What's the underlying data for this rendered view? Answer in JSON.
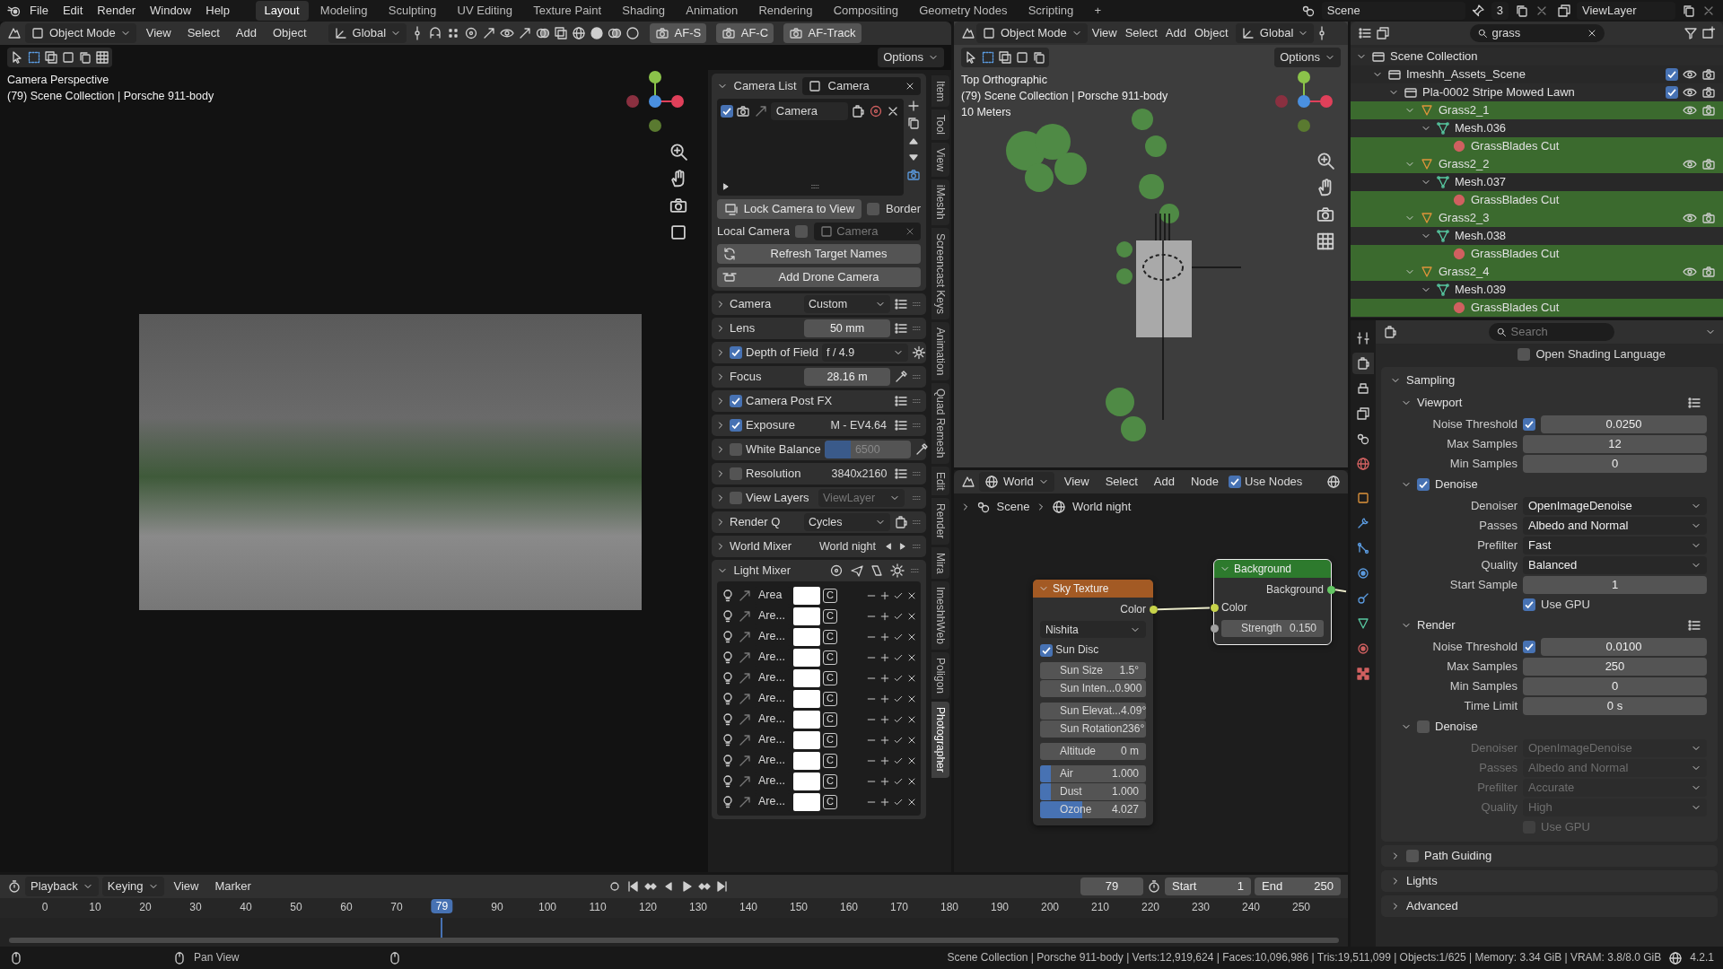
{
  "menu": [
    "File",
    "Edit",
    "Render",
    "Window",
    "Help"
  ],
  "workspaces": [
    {
      "label": "Layout",
      "selected": true
    },
    {
      "label": "Modeling",
      "selected": false
    },
    {
      "label": "Sculpting",
      "selected": false
    },
    {
      "label": "UV Editing",
      "selected": false
    },
    {
      "label": "Texture Paint",
      "selected": false
    },
    {
      "label": "Shading",
      "selected": false
    },
    {
      "label": "Animation",
      "selected": false
    },
    {
      "label": "Rendering",
      "selected": false
    },
    {
      "label": "Compositing",
      "selected": false
    },
    {
      "label": "Geometry Nodes",
      "selected": false
    },
    {
      "label": "Scripting",
      "selected": false
    }
  ],
  "add_workspace": "+",
  "scene": {
    "name": "Scene",
    "users": "3"
  },
  "view_layer": "ViewLayer",
  "viewport": {
    "mode": "Object Mode",
    "menus": [
      "View",
      "Select",
      "Add",
      "Object"
    ],
    "orientation": "Global",
    "focus_buttons": [
      "AF-S",
      "AF-C",
      "AF-Track"
    ],
    "options": "Options",
    "info": [
      "Camera Perspective",
      "(79) Scene Collection | Porsche 911-body"
    ]
  },
  "camera_panel": {
    "title": "Camera List",
    "camera": "Camera",
    "list": [
      {
        "name": "Camera",
        "checked": true
      }
    ],
    "lock_button": "Lock Camera to View",
    "border": {
      "label": "Border",
      "checked": false
    },
    "local_camera": {
      "label": "Local Camera",
      "checked": false,
      "camera": "Camera"
    },
    "refresh_button": "Refresh Target Names",
    "drone_button": "Add Drone Camera"
  },
  "panel_rows": [
    {
      "kind": "dropdown",
      "label": "Camera",
      "value": "Custom",
      "disabled": false
    },
    {
      "kind": "number",
      "label": "Lens",
      "value": "50 mm",
      "disabled": false
    },
    {
      "kind": "dropdown",
      "label": "Depth of Field",
      "checked": true,
      "value": "f / 4.9",
      "disabled": false
    },
    {
      "kind": "number",
      "label": "Focus",
      "value": "28.16 m",
      "disabled": false
    },
    {
      "kind": "plain",
      "label": "Camera Post FX",
      "checked": true,
      "disabled": false
    },
    {
      "kind": "text",
      "label": "Exposure",
      "checked": true,
      "value": "M - EV4.64",
      "disabled": false
    },
    {
      "kind": "slider",
      "label": "White Balance",
      "checked": false,
      "value": "6500",
      "level": 0.3,
      "disabled": true
    },
    {
      "kind": "text",
      "label": "Resolution",
      "checked": false,
      "value": "3840x2160",
      "disabled": false
    },
    {
      "kind": "dropdown",
      "label": "View Layers",
      "checked": false,
      "value": "ViewLayer",
      "disabled": true
    },
    {
      "kind": "dropdown",
      "label": "Render Q",
      "value": "Cycles",
      "disabled": false
    },
    {
      "kind": "stepper",
      "label": "World Mixer",
      "value": "World night",
      "disabled": false
    }
  ],
  "light_mixer": {
    "title": "Light Mixer",
    "lights": [
      {
        "name": "Area",
        "key": "C"
      },
      {
        "name": "Are...",
        "key": "C"
      },
      {
        "name": "Are...",
        "key": "C"
      },
      {
        "name": "Are...",
        "key": "C"
      },
      {
        "name": "Are...",
        "key": "C"
      },
      {
        "name": "Are...",
        "key": "C"
      },
      {
        "name": "Are...",
        "key": "C"
      },
      {
        "name": "Are...",
        "key": "C"
      },
      {
        "name": "Are...",
        "key": "C"
      },
      {
        "name": "Are...",
        "key": "C"
      },
      {
        "name": "Are...",
        "key": "C"
      }
    ]
  },
  "side_tabs": [
    {
      "label": "Item",
      "selected": false
    },
    {
      "label": "Tool",
      "selected": false
    },
    {
      "label": "View",
      "selected": false
    },
    {
      "label": "iMeshh",
      "selected": false
    },
    {
      "label": "Screencast Keys",
      "selected": false
    },
    {
      "label": "Animation",
      "selected": false
    },
    {
      "label": "Quad Remesh",
      "selected": false
    },
    {
      "label": "Edit",
      "selected": false
    },
    {
      "label": "Render",
      "selected": false
    },
    {
      "label": "Mira",
      "selected": false
    },
    {
      "label": "ImeshhWeb",
      "selected": false
    },
    {
      "label": "Poligon",
      "selected": false
    },
    {
      "label": "Photographer",
      "selected": true
    }
  ],
  "top_viewport": {
    "mode": "Object Mode",
    "menus": [
      "View",
      "Select",
      "Add",
      "Object"
    ],
    "orientation": "Global",
    "options": "Options",
    "info": [
      "Top Orthographic",
      "(79) Scene Collection | Porsche 911-body",
      "10 Meters"
    ]
  },
  "outliner": {
    "search": "grass",
    "tree": [
      {
        "name": "Scene Collection",
        "kind": "scene",
        "highlighted": false,
        "children": [
          {
            "name": "Imeshh_Assets_Scene",
            "kind": "collection",
            "checked": true,
            "highlighted": false,
            "children": [
              {
                "name": "Pla-0002 Stripe Mowed Lawn",
                "kind": "collection",
                "checked": true,
                "highlighted": false,
                "children": [
                  {
                    "name": "Grass2_1",
                    "kind": "object",
                    "highlighted": true,
                    "children": [
                      {
                        "name": "Mesh.036",
                        "kind": "mesh",
                        "highlighted": false,
                        "children": [
                          {
                            "name": "GrassBlades Cut",
                            "kind": "material",
                            "highlighted": true
                          }
                        ]
                      }
                    ]
                  },
                  {
                    "name": "Grass2_2",
                    "kind": "object",
                    "highlighted": true,
                    "children": [
                      {
                        "name": "Mesh.037",
                        "kind": "mesh",
                        "highlighted": false,
                        "children": [
                          {
                            "name": "GrassBlades Cut",
                            "kind": "material",
                            "highlighted": true
                          }
                        ]
                      }
                    ]
                  },
                  {
                    "name": "Grass2_3",
                    "kind": "object",
                    "highlighted": true,
                    "children": [
                      {
                        "name": "Mesh.038",
                        "kind": "mesh",
                        "highlighted": false,
                        "children": [
                          {
                            "name": "GrassBlades Cut",
                            "kind": "material",
                            "highlighted": true
                          }
                        ]
                      }
                    ]
                  },
                  {
                    "name": "Grass2_4",
                    "kind": "object",
                    "highlighted": true,
                    "children": [
                      {
                        "name": "Mesh.039",
                        "kind": "mesh",
                        "highlighted": false,
                        "children": [
                          {
                            "name": "GrassBlades Cut",
                            "kind": "material",
                            "highlighted": true
                          }
                        ]
                      }
                    ]
                  }
                ]
              }
            ]
          }
        ]
      }
    ]
  },
  "node_editor": {
    "world": "World",
    "menus": [
      "View",
      "Select",
      "Add",
      "Node"
    ],
    "use_nodes": {
      "label": "Use Nodes",
      "checked": true
    },
    "breadcrumb": [
      "Scene",
      "World night"
    ],
    "nodes": [
      {
        "kind": "texture",
        "title": "Sky Texture",
        "output": "Color",
        "sky_type": "Nishita",
        "sun_disc": {
          "label": "Sun Disc",
          "checked": true
        },
        "field_groups": [
          [
            {
              "label": "Sun Size",
              "value": "1.5°"
            },
            {
              "label": "Sun Inten...",
              "value": "0.900"
            }
          ],
          [
            {
              "label": "Sun Elevat...",
              "value": "4.09°"
            },
            {
              "label": "Sun Rotation",
              "value": "236°"
            }
          ],
          [
            {
              "label": "Altitude",
              "value": "0 m"
            }
          ],
          [
            {
              "label": "Air",
              "value": "1.000",
              "level": 0.1
            },
            {
              "label": "Dust",
              "value": "1.000",
              "level": 0.1
            },
            {
              "label": "Ozone",
              "value": "4.027",
              "level": 0.4
            }
          ]
        ]
      },
      {
        "kind": "shader",
        "title": "Background",
        "output": "Background",
        "input": "Color",
        "field_groups": [
          [
            {
              "label": "Strength",
              "value": "0.150"
            }
          ]
        ]
      }
    ]
  },
  "property_tabs": [
    {
      "selected": false
    },
    {
      "selected": true
    },
    {
      "selected": false
    },
    {
      "selected": false
    },
    {
      "selected": false
    },
    {
      "selected": false
    },
    {
      "selected": false
    },
    {
      "selected": false
    },
    {
      "selected": false
    },
    {
      "selected": false
    },
    {
      "selected": false
    },
    {
      "selected": false
    },
    {
      "selected": false
    },
    {
      "selected": false
    }
  ],
  "properties": {
    "search_placeholder": "Search",
    "osl": {
      "label": "Open Shading Language",
      "checked": false
    },
    "section": "Sampling",
    "groups": [
      {
        "title": "Viewport",
        "rows": [
          {
            "kind": "number",
            "label": "Noise Threshold",
            "checked": true,
            "value": "0.0250"
          },
          {
            "kind": "number",
            "label": "Max Samples",
            "value": "12"
          },
          {
            "kind": "number",
            "label": "Min Samples",
            "value": "0"
          }
        ],
        "denoise": {
          "label": "Denoise",
          "checked": true,
          "rows": [
            {
              "kind": "dropdown",
              "label": "Denoiser",
              "value": "OpenImageDenoise"
            },
            {
              "kind": "dropdown",
              "label": "Passes",
              "value": "Albedo and Normal"
            },
            {
              "kind": "dropdown",
              "label": "Prefilter",
              "value": "Fast"
            },
            {
              "kind": "dropdown",
              "label": "Quality",
              "value": "Balanced"
            },
            {
              "kind": "number",
              "label": "Start Sample",
              "value": "1"
            },
            {
              "kind": "check",
              "label": "Use GPU",
              "checked": true
            }
          ]
        }
      },
      {
        "title": "Render",
        "rows": [
          {
            "kind": "number",
            "label": "Noise Threshold",
            "checked": true,
            "value": "0.0100"
          },
          {
            "kind": "number",
            "label": "Max Samples",
            "value": "250"
          },
          {
            "kind": "number",
            "label": "Min Samples",
            "value": "0"
          },
          {
            "kind": "number",
            "label": "Time Limit",
            "value": "0 s"
          }
        ],
        "denoise": {
          "label": "Denoise",
          "checked": false,
          "rows": [
            {
              "kind": "dropdown",
              "label": "Denoiser",
              "value": "OpenImageDenoise"
            },
            {
              "kind": "dropdown",
              "label": "Passes",
              "value": "Albedo and Normal"
            },
            {
              "kind": "dropdown",
              "label": "Prefilter",
              "value": "Accurate"
            },
            {
              "kind": "dropdown",
              "label": "Quality",
              "value": "High"
            },
            {
              "kind": "check",
              "label": "Use GPU",
              "checked": false
            }
          ]
        }
      }
    ],
    "collapsed": [
      {
        "label": "Path Guiding",
        "checked": false
      },
      {
        "label": "Lights"
      },
      {
        "label": "Advanced"
      }
    ]
  },
  "timeline": {
    "menus": [
      "Playback",
      "Keying",
      "View",
      "Marker"
    ],
    "frame": "79",
    "start": {
      "label": "Start",
      "value": "1"
    },
    "end": {
      "label": "End",
      "value": "250"
    },
    "ticks": [
      "0",
      "10",
      "20",
      "30",
      "40",
      "50",
      "60",
      "70",
      "90",
      "100",
      "110",
      "120",
      "130",
      "140",
      "150",
      "160",
      "170",
      "180",
      "190",
      "200",
      "210",
      "220",
      "230",
      "240",
      "250"
    ],
    "current_marker": "79"
  },
  "status_bar": {
    "hint": "Pan View",
    "stats": "Scene Collection | Porsche 911-body | Verts:12,919,624 | Faces:10,096,986 | Tris:19,511,099 | Objects:1/625 | Memory: 3.34 GiB | VRAM: 3.8/8.0 GiB",
    "version": "4.2.1"
  }
}
